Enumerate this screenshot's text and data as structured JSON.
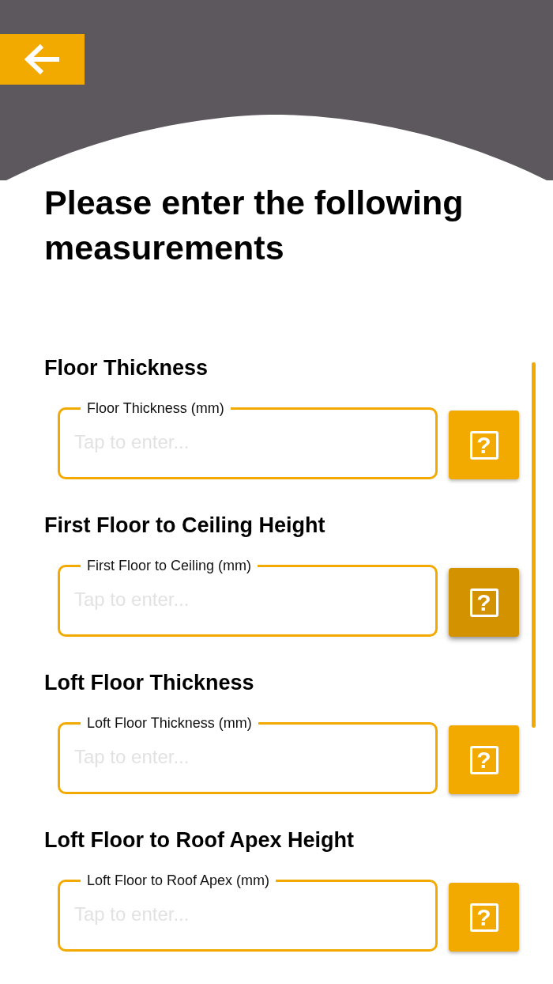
{
  "title": "Please enter the following measurements",
  "sections": [
    {
      "heading": "Floor Thickness",
      "label": "Floor Thickness (mm)",
      "placeholder": "Tap to enter...",
      "help_icon": "?",
      "help_pressed": false
    },
    {
      "heading": "First Floor to Ceiling Height",
      "label": "First Floor to Ceiling (mm)",
      "placeholder": "Tap to enter...",
      "help_icon": "?",
      "help_pressed": true
    },
    {
      "heading": "Loft Floor Thickness",
      "label": "Loft Floor Thickness (mm)",
      "placeholder": "Tap to enter...",
      "help_icon": "?",
      "help_pressed": false
    },
    {
      "heading": "Loft Floor to Roof Apex Height",
      "label": "Loft Floor to Roof Apex (mm)",
      "placeholder": "Tap to enter...",
      "help_icon": "?",
      "help_pressed": false
    }
  ]
}
